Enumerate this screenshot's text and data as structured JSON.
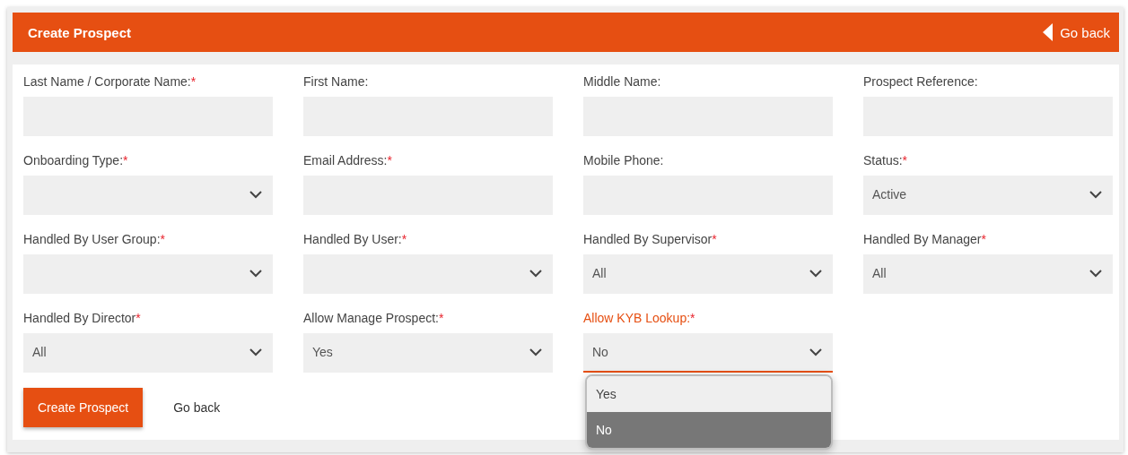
{
  "header": {
    "title": "Create Prospect",
    "back_link": "Go back"
  },
  "fields": [
    {
      "label": "Last Name / Corporate Name:",
      "required_mark": "*",
      "kind": "text",
      "focused": false
    },
    {
      "label": "First Name:",
      "kind": "text",
      "focused": false
    },
    {
      "label": "Middle Name:",
      "kind": "text",
      "focused": false
    },
    {
      "label": "Prospect Reference:",
      "kind": "text",
      "focused": false
    },
    {
      "label": "Onboarding Type:",
      "required_mark": "*",
      "kind": "select",
      "focused": false
    },
    {
      "label": "Email Address:",
      "required_mark": "*",
      "kind": "text",
      "focused": false
    },
    {
      "label": "Mobile Phone:",
      "kind": "text",
      "focused": false
    },
    {
      "label": "Status:",
      "required_mark": "*",
      "kind": "select",
      "value": "Active",
      "focused": false
    },
    {
      "label": "Handled By User Group:",
      "required_mark": "*",
      "kind": "select",
      "focused": false
    },
    {
      "label": "Handled By User:",
      "required_mark": "*",
      "kind": "select",
      "focused": false
    },
    {
      "label": "Handled By Supervisor",
      "required_mark": "*",
      "kind": "select",
      "value": "All",
      "focused": false
    },
    {
      "label": "Handled By Manager",
      "required_mark": "*",
      "kind": "select",
      "value": "All",
      "focused": false
    },
    {
      "label": "Handled By Director",
      "required_mark": "*",
      "kind": "select",
      "value": "All",
      "focused": false
    },
    {
      "label": "Allow Manage Prospect:",
      "required_mark": "*",
      "kind": "select",
      "value": "Yes",
      "focused": false
    },
    {
      "label": "Allow KYB Lookup:",
      "required_mark": "*",
      "kind": "select",
      "value": "No",
      "focused": true,
      "options": [
        {
          "label": "Yes",
          "selected": false
        },
        {
          "label": "No",
          "selected": true
        }
      ]
    }
  ],
  "actions": {
    "submit": "Create Prospect",
    "back": "Go back"
  }
}
